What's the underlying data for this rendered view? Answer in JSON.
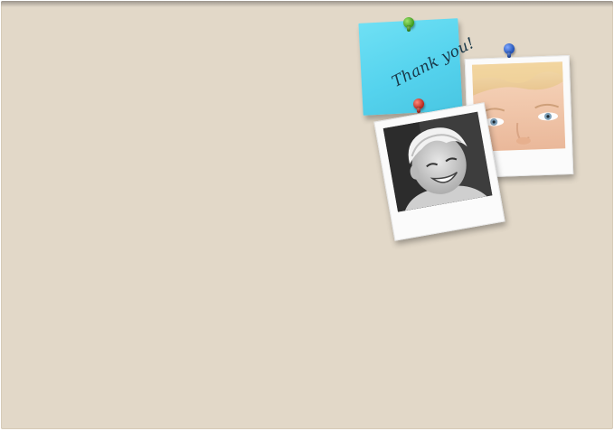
{
  "board": {
    "background_color": "#e2d8c8"
  },
  "sticky_note": {
    "text": "Thank you!",
    "color": "#55d3ee"
  },
  "pins": [
    {
      "name": "pushpin-green-icon",
      "color": "#3b9a1e"
    },
    {
      "name": "pushpin-blue-icon",
      "color": "#1e4fb3"
    },
    {
      "name": "pushpin-red-icon",
      "color": "#b3241a"
    }
  ],
  "photos": [
    {
      "name": "polaroid-color-photo",
      "subject": "child-eyes-closeup"
    },
    {
      "name": "polaroid-bw-photo",
      "subject": "smiling-child-black-and-white"
    }
  ]
}
